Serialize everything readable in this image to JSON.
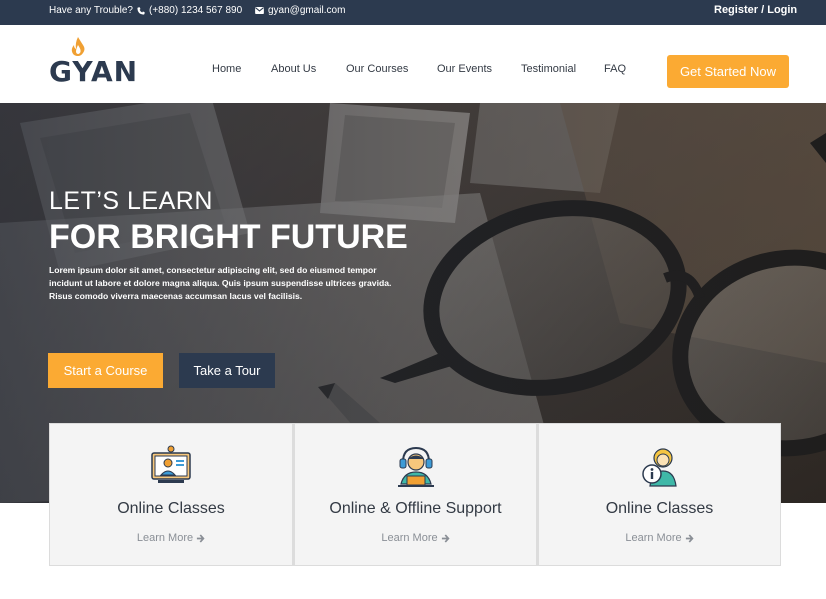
{
  "topbar": {
    "trouble": "Have any Trouble?",
    "phone": "(+880) 1234 567 890",
    "email": "gyan@gmail.com",
    "register": "Register",
    "separator": "/",
    "login": "Login"
  },
  "header": {
    "logo_text": "GYAN",
    "nav": [
      "Home",
      "About Us",
      "Our Courses",
      "Our Events",
      "Testimonial",
      "FAQ"
    ],
    "cta": "Get Started Now"
  },
  "hero": {
    "subtitle": "LET’S LEARN",
    "title": "FOR BRIGHT FUTURE",
    "text": "Lorem ipsum dolor sit amet, consectetur adipiscing elit, sed do eiusmod tempor incidunt ut labore et dolore magna aliqua. Quis ipsum suspendisse ultrices gravida. Risus comodo viverra maecenas accumsan lacus vel facilisis.",
    "primary_button": "Start a Course",
    "secondary_button": "Take a Tour"
  },
  "features": [
    {
      "title": "Online Classes",
      "link": "Learn More",
      "icon": "online-class-icon"
    },
    {
      "title": "Online & Offline Support",
      "link": "Learn More",
      "icon": "support-agent-icon"
    },
    {
      "title": "Online Classes",
      "link": "Learn More",
      "icon": "info-person-icon"
    }
  ],
  "colors": {
    "primary_dark": "#2c3a4f",
    "accent": "#fbaa33",
    "card_bg": "#f4f4f4"
  }
}
